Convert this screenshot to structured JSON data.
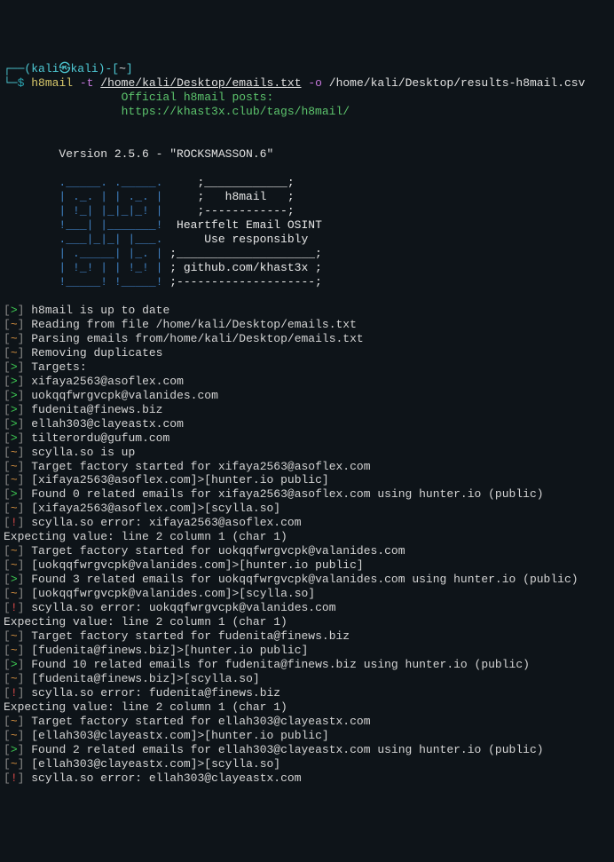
{
  "prompt": {
    "open_paren": "┌──(",
    "user": "kali",
    "at": "㉿",
    "host": "kali",
    "close_paren": ")-[",
    "tilde": "~",
    "close_br": "]",
    "line2_start": "└─",
    "dollar": "$",
    "cmd": "h8mail",
    "flag_t": "-t",
    "path_t": "/home/kali/Desktop/emails.txt",
    "flag_o": "-o",
    "path_o": "/home/kali/Desktop/results-h8mail.csv"
  },
  "header": {
    "line1": "                 Official h8mail posts: ",
    "line2": "                 https://khast3x.club/tags/h8mail/"
  },
  "version": "        Version 2.5.6 - \"ROCKSMASSON.6\"",
  "ascii": {
    "l1a": "        ._____. ._____.     ",
    "l1b": ";____________;",
    "l2a": "        | ._. | | ._. |     ",
    "l2b": ";   h8mail   ;",
    "l3a": "        | !_| |_|_|_! |     ",
    "l3b": ";------------;",
    "l4a": "        !___| |_______!  ",
    "l4b": "Heartfelt Email OSINT",
    "l5a": "        .___|_|_| |___.   ",
    "l5b": "   Use responsibly",
    "l6a": "        | ._____| |_. | ",
    "l6b": ";____________________;",
    "l7a": "        | !_! | | !_! | ",
    "l7b": "; github.com/khast3x ;",
    "l8a": "        !_____! !_____! ",
    "l8b": ";--------------------;"
  },
  "lines": [
    {
      "sym": ">",
      "txt": "h8mail is up to date"
    },
    {
      "sym": "~",
      "txt": "Reading from file /home/kali/Desktop/emails.txt"
    },
    {
      "sym": "~",
      "txt": "Parsing emails from/home/kali/Desktop/emails.txt"
    },
    {
      "sym": "~",
      "txt": "Removing duplicates"
    },
    {
      "sym": ">",
      "txt": "Targets:"
    },
    {
      "sym": ">",
      "txt": "xifaya2563@asoflex.com"
    },
    {
      "sym": ">",
      "txt": "uokqqfwrgvcpk@valanides.com"
    },
    {
      "sym": ">",
      "txt": "fudenita@finews.biz"
    },
    {
      "sym": ">",
      "txt": "ellah303@clayeastx.com"
    },
    {
      "sym": ">",
      "txt": "tilterordu@gufum.com"
    },
    {
      "sym": "~",
      "txt": "scylla.so is up"
    },
    {
      "sym": "~",
      "txt": "Target factory started for xifaya2563@asoflex.com"
    },
    {
      "sym": "~",
      "txt": "[xifaya2563@asoflex.com]>[hunter.io public]"
    },
    {
      "sym": ">",
      "txt": "Found 0 related emails for xifaya2563@asoflex.com using hunter.io (public)"
    },
    {
      "sym": "~",
      "txt": "[xifaya2563@asoflex.com]>[scylla.so]"
    },
    {
      "sym": "!",
      "txt": "scylla.so error: xifaya2563@asoflex.com"
    },
    {
      "sym": "",
      "txt": "Expecting value: line 2 column 1 (char 1)"
    },
    {
      "sym": "~",
      "txt": "Target factory started for uokqqfwrgvcpk@valanides.com"
    },
    {
      "sym": "~",
      "txt": "[uokqqfwrgvcpk@valanides.com]>[hunter.io public]"
    },
    {
      "sym": ">",
      "txt": "Found 3 related emails for uokqqfwrgvcpk@valanides.com using hunter.io (public)"
    },
    {
      "sym": "~",
      "txt": "[uokqqfwrgvcpk@valanides.com]>[scylla.so]"
    },
    {
      "sym": "!",
      "txt": "scylla.so error: uokqqfwrgvcpk@valanides.com"
    },
    {
      "sym": "",
      "txt": "Expecting value: line 2 column 1 (char 1)"
    },
    {
      "sym": "~",
      "txt": "Target factory started for fudenita@finews.biz"
    },
    {
      "sym": "~",
      "txt": "[fudenita@finews.biz]>[hunter.io public]"
    },
    {
      "sym": ">",
      "txt": "Found 10 related emails for fudenita@finews.biz using hunter.io (public)"
    },
    {
      "sym": "~",
      "txt": "[fudenita@finews.biz]>[scylla.so]"
    },
    {
      "sym": "!",
      "txt": "scylla.so error: fudenita@finews.biz"
    },
    {
      "sym": "",
      "txt": "Expecting value: line 2 column 1 (char 1)"
    },
    {
      "sym": "~",
      "txt": "Target factory started for ellah303@clayeastx.com"
    },
    {
      "sym": "~",
      "txt": "[ellah303@clayeastx.com]>[hunter.io public]"
    },
    {
      "sym": ">",
      "txt": "Found 2 related emails for ellah303@clayeastx.com using hunter.io (public)"
    },
    {
      "sym": "~",
      "txt": "[ellah303@clayeastx.com]>[scylla.so]"
    },
    {
      "sym": "!",
      "txt": "scylla.so error: ellah303@clayeastx.com"
    }
  ]
}
